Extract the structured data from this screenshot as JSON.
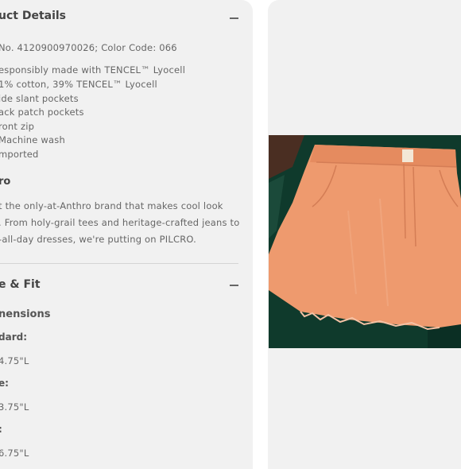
{
  "product_details": {
    "title": "uct Details",
    "style_line": "No. 4120900970026; Color Code: 066",
    "features": [
      "esponsibly made with TENCEL™ Lyocell",
      "1% cotton, 39% TENCEL™ Lyocell",
      "ide slant pockets",
      "ack patch pockets",
      "ront zip",
      "Machine wash",
      "mported"
    ],
    "brand_heading": "ro",
    "brand_lines": [
      "t the only-at-Anthro brand that makes cool look",
      ". From holy-grail tees and heritage-crafted jeans to",
      "-all-day dresses, we're putting on PILCRO."
    ]
  },
  "size_fit": {
    "title": "e & Fit",
    "dimensions_heading": "nensions",
    "groups": [
      {
        "label": "dard:",
        "value": "4.75\"L"
      },
      {
        "label": "e:",
        "value": "3.75\"L"
      },
      {
        "label": ":",
        "value": "6.75\"L"
      }
    ]
  },
  "icons": {
    "collapse": "minus-icon"
  },
  "colors": {
    "panel_bg": "#f1f1f1",
    "skirt": "#ee9a6e",
    "background_fabric": "#0f3a2c"
  }
}
